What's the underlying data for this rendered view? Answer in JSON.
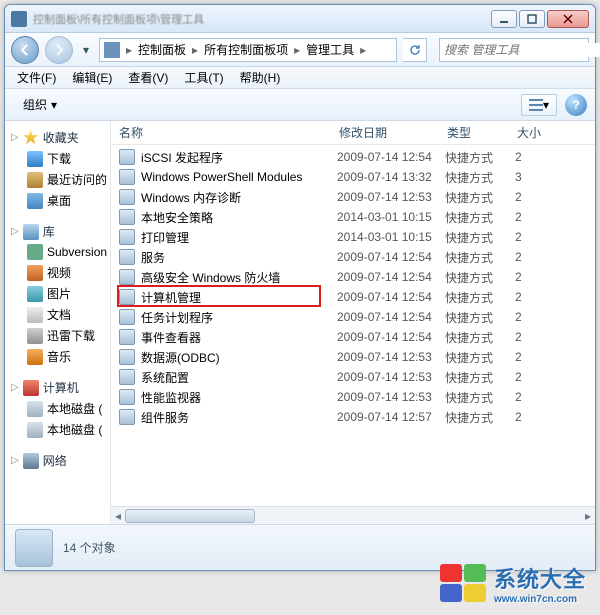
{
  "titlebar": {
    "title": "控制面板\\所有控制面板项\\管理工具"
  },
  "winbtns": {
    "min": "min",
    "max": "max",
    "close": "close"
  },
  "breadcrumb": {
    "items": [
      "控制面板",
      "所有控制面板项",
      "管理工具"
    ]
  },
  "search": {
    "placeholder": "搜索 管理工具"
  },
  "menubar": {
    "file": "文件(F)",
    "edit": "编辑(E)",
    "view": "查看(V)",
    "tools": "工具(T)",
    "help": "帮助(H)"
  },
  "toolbar": {
    "organize": "组织"
  },
  "columns": {
    "name": "名称",
    "date": "修改日期",
    "type": "类型",
    "size": "大小"
  },
  "sidebar": {
    "fav_header": "收藏夹",
    "fav": [
      "下载",
      "最近访问的",
      "桌面"
    ],
    "lib_header": "库",
    "lib": [
      "Subversion",
      "视频",
      "图片",
      "文档",
      "迅雷下载",
      "音乐"
    ],
    "comp_header": "计算机",
    "comp": [
      "本地磁盘 (",
      "本地磁盘 ("
    ],
    "net_header": "网络"
  },
  "rows": [
    {
      "name": "iSCSI 发起程序",
      "date": "2009-07-14 12:54",
      "type": "快捷方式",
      "size": "2"
    },
    {
      "name": "Windows PowerShell Modules",
      "date": "2009-07-14 13:32",
      "type": "快捷方式",
      "size": "3"
    },
    {
      "name": "Windows 内存诊断",
      "date": "2009-07-14 12:53",
      "type": "快捷方式",
      "size": "2"
    },
    {
      "name": "本地安全策略",
      "date": "2014-03-01 10:15",
      "type": "快捷方式",
      "size": "2"
    },
    {
      "name": "打印管理",
      "date": "2014-03-01 10:15",
      "type": "快捷方式",
      "size": "2"
    },
    {
      "name": "服务",
      "date": "2009-07-14 12:54",
      "type": "快捷方式",
      "size": "2"
    },
    {
      "name": "高级安全 Windows 防火墙",
      "date": "2009-07-14 12:54",
      "type": "快捷方式",
      "size": "2"
    },
    {
      "name": "计算机管理",
      "date": "2009-07-14 12:54",
      "type": "快捷方式",
      "size": "2"
    },
    {
      "name": "任务计划程序",
      "date": "2009-07-14 12:54",
      "type": "快捷方式",
      "size": "2"
    },
    {
      "name": "事件查看器",
      "date": "2009-07-14 12:54",
      "type": "快捷方式",
      "size": "2"
    },
    {
      "name": "数据源(ODBC)",
      "date": "2009-07-14 12:53",
      "type": "快捷方式",
      "size": "2"
    },
    {
      "name": "系统配置",
      "date": "2009-07-14 12:53",
      "type": "快捷方式",
      "size": "2"
    },
    {
      "name": "性能监视器",
      "date": "2009-07-14 12:53",
      "type": "快捷方式",
      "size": "2"
    },
    {
      "name": "组件服务",
      "date": "2009-07-14 12:57",
      "type": "快捷方式",
      "size": "2"
    }
  ],
  "highlight_index": 7,
  "status": {
    "count_text": "14 个对象"
  },
  "watermark": {
    "line1": "系统大全",
    "line2": "www.win7cn.com"
  }
}
